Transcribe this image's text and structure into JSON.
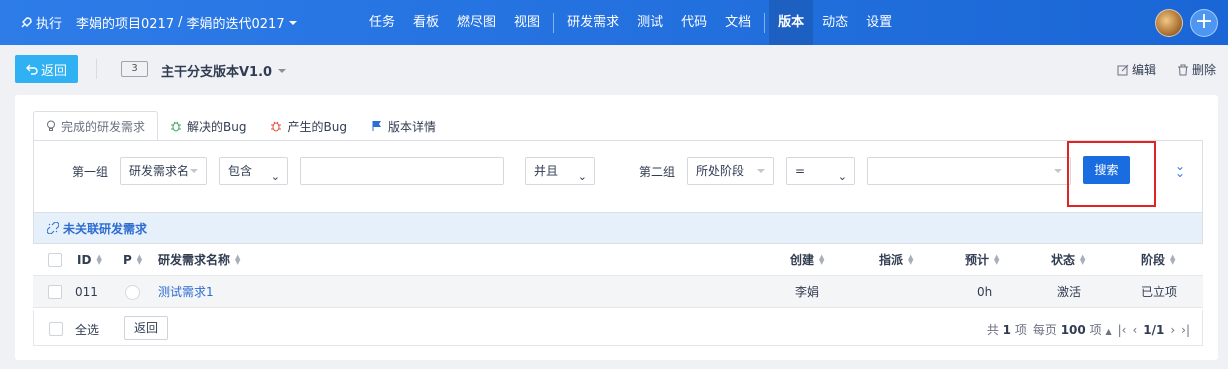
{
  "topbar": {
    "exec_label": "执行",
    "project": "李娟的项目0217",
    "separator": "/",
    "iteration": "李娟的迭代0217",
    "nav": [
      "任务",
      "看板",
      "燃尽图",
      "视图",
      "研发需求",
      "测试",
      "代码",
      "文档",
      "版本",
      "动态",
      "设置"
    ],
    "active_nav": "版本",
    "plus": "+"
  },
  "subheader": {
    "back": "返回",
    "version_id": "3",
    "version_name": "主干分支版本V1.0",
    "edit": "编辑",
    "delete": "删除"
  },
  "tabs": [
    "完成的研发需求",
    "解决的Bug",
    "产生的Bug",
    "版本详情"
  ],
  "filter": {
    "group1": "第一组",
    "field1": "研发需求名",
    "op1": "包含",
    "value1": "",
    "logic": "并且",
    "group2": "第二组",
    "field2": "所处阶段",
    "op2": "=",
    "value2": "",
    "search": "搜索"
  },
  "unlinked_label": "未关联研发需求",
  "table": {
    "headers": {
      "id": "ID",
      "pri": "P",
      "name": "研发需求名称",
      "creator": "创建",
      "assign": "指派",
      "estimate": "预计",
      "status": "状态",
      "stage": "阶段"
    },
    "rows": [
      {
        "id": "011",
        "name": "测试需求1",
        "creator": "李娟",
        "assign": "",
        "estimate": "0h",
        "status": "激活",
        "stage": "已立项"
      }
    ]
  },
  "footer": {
    "select_all": "全选",
    "back": "返回",
    "total_pre": "共",
    "total": "1",
    "total_post": "项",
    "per_pre": "每页",
    "per": "100",
    "per_post": "项",
    "page": "1/1"
  },
  "colors": {
    "topbar": "#1a66d6",
    "primary": "#1a6de0",
    "back_button": "#2fb1f3",
    "highlight_box": "#e02424",
    "link": "#2d6cd0"
  }
}
